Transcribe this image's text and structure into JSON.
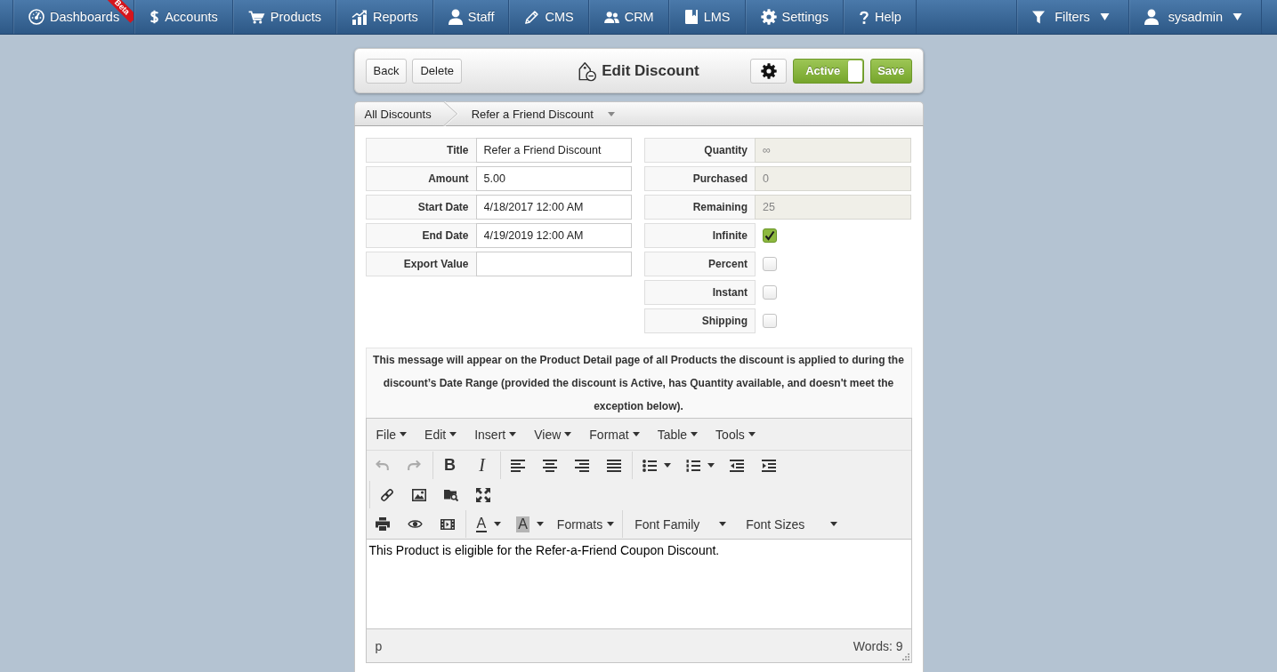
{
  "top_nav": {
    "items": [
      {
        "label": "Dashboards",
        "badge": "Beta"
      },
      {
        "label": "Accounts"
      },
      {
        "label": "Products"
      },
      {
        "label": "Reports"
      },
      {
        "label": "Staff"
      },
      {
        "label": "CMS"
      },
      {
        "label": "CRM"
      },
      {
        "label": "LMS"
      },
      {
        "label": "Settings"
      },
      {
        "label": "Help"
      }
    ],
    "filters": {
      "label": "Filters"
    },
    "user_menu": {
      "label": "sysadmin"
    }
  },
  "header": {
    "buttons": [
      "Back",
      "Delete"
    ],
    "title": "Edit Discount",
    "toggle": {
      "label": "Active",
      "on": true
    },
    "save": "Save"
  },
  "breadcrumbs": {
    "items": [
      "All Discounts",
      "Refer a Friend Discount"
    ]
  },
  "form": {
    "left_fields": [
      {
        "kind": "text",
        "label": "Title",
        "value": "Refer a Friend Discount"
      },
      {
        "kind": "text",
        "label": "Amount",
        "value": "5.00"
      },
      {
        "kind": "text",
        "label": "Start Date",
        "value": "4/18/2017 12:00 AM"
      },
      {
        "kind": "text",
        "label": "End Date",
        "value": "4/19/2019 12:00 AM"
      },
      {
        "kind": "text",
        "label": "Export Value"
      }
    ],
    "right_fields": [
      {
        "kind": "readonly",
        "label": "Quantity",
        "value": "∞"
      },
      {
        "kind": "readonly",
        "label": "Purchased",
        "value": "0"
      },
      {
        "kind": "readonly",
        "label": "Remaining",
        "value": "25"
      },
      {
        "kind": "checkbox",
        "label": "Infinite",
        "checked": true
      },
      {
        "kind": "checkbox",
        "label": "Percent",
        "checked": false
      },
      {
        "kind": "checkbox",
        "label": "Instant",
        "checked": false
      },
      {
        "kind": "checkbox",
        "label": "Shipping",
        "checked": false
      }
    ]
  },
  "message": {
    "text": "This message will appear on the Product Detail page of all Products the discount is applied to during the discount’s Date Range (provided the discount is Active, has Quantity available, and doesn't meet the exception below)."
  },
  "editor": {
    "menubar": [
      "File",
      "Edit",
      "Insert",
      "View",
      "Format",
      "Table",
      "Tools"
    ],
    "toolbar": {
      "undo": {
        "disabled": true
      },
      "redo": {
        "disabled": true
      },
      "bold": "B",
      "italic": "I",
      "text_color": "A",
      "background_color": "A",
      "dropdowns": [
        "Formats",
        "Font Family",
        "Font Sizes"
      ]
    },
    "content": "This Product is eligible for the Refer-a-Friend Coupon Discount.",
    "status": {
      "path": "p",
      "word_count": "Words: 9"
    }
  }
}
